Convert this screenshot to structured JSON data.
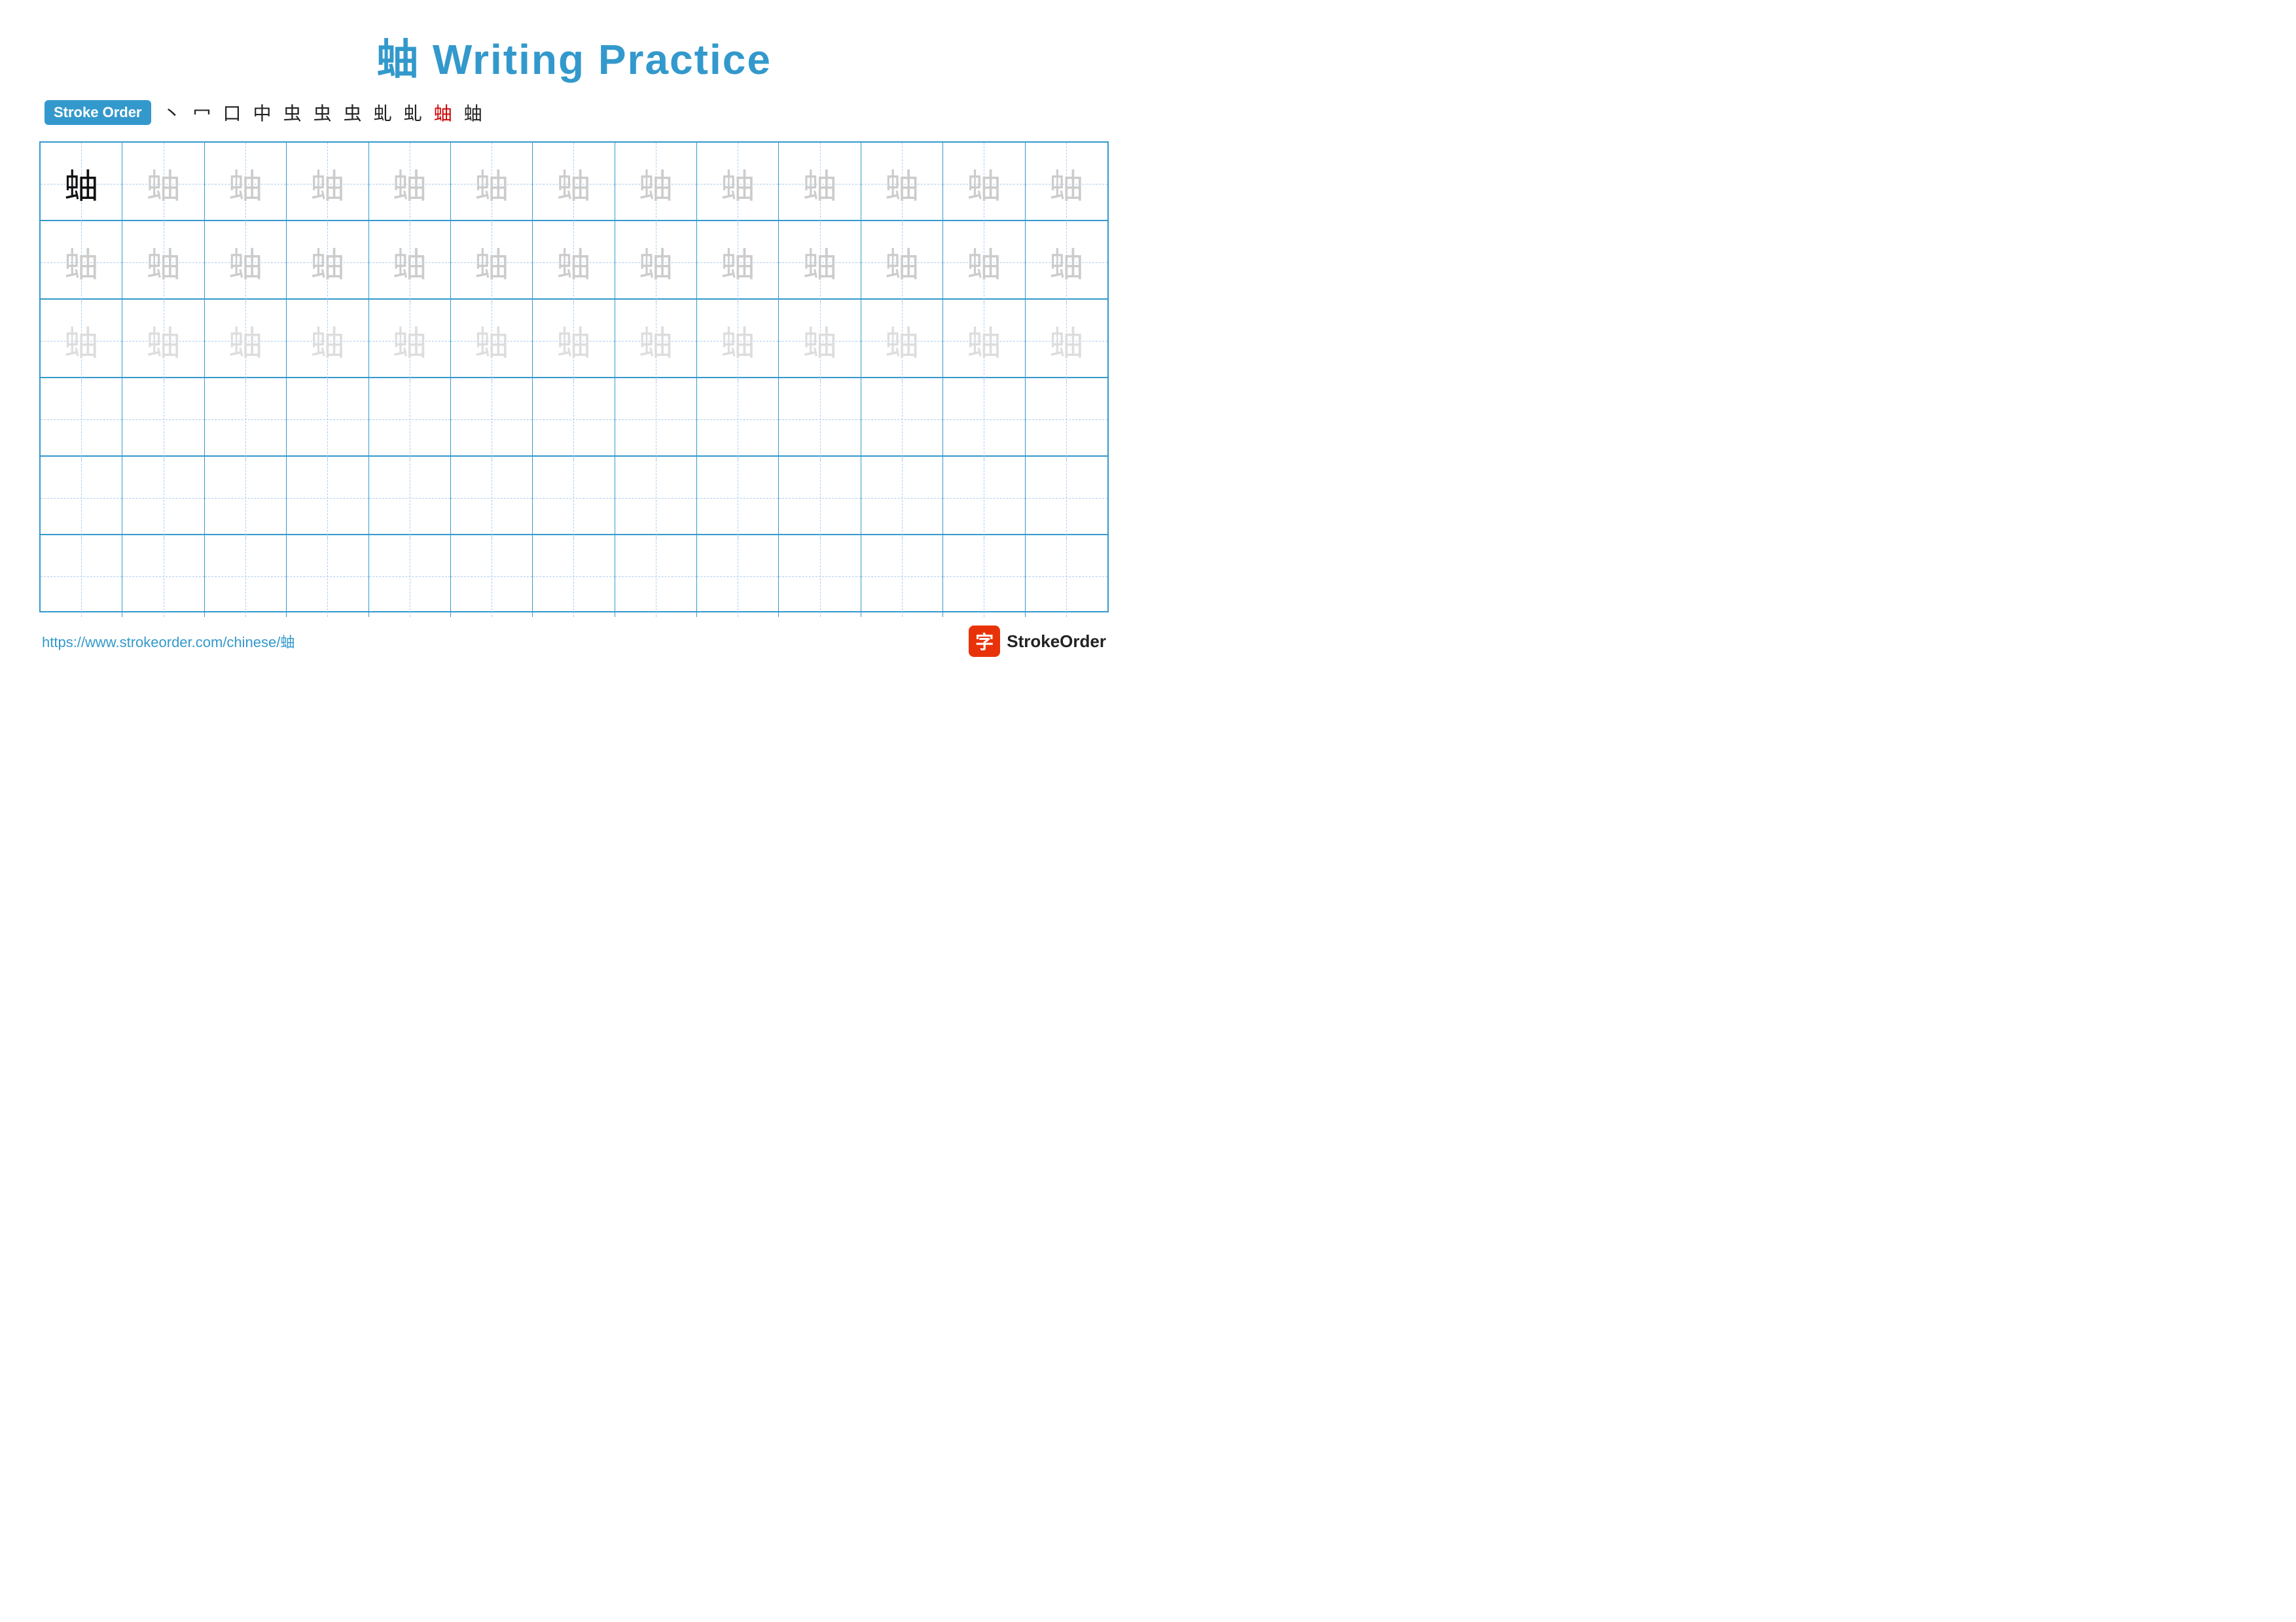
{
  "title": {
    "char": "蚰",
    "text": " Writing Practice"
  },
  "stroke_order": {
    "badge_label": "Stroke Order",
    "steps": [
      "丶",
      "冖",
      "口",
      "中",
      "虫",
      "虫",
      "虫",
      "虬",
      "虬",
      "蚰",
      "蚰"
    ]
  },
  "grid": {
    "rows": 6,
    "cols": 13,
    "char": "蚰",
    "row1_style": "solid_then_light",
    "row2_style": "light",
    "row3_style": "lighter",
    "row4_style": "empty",
    "row5_style": "empty",
    "row6_style": "empty"
  },
  "footer": {
    "url": "https://www.strokeorder.com/chinese/蚰",
    "logo_text": "StrokeOrder",
    "logo_char": "字"
  }
}
